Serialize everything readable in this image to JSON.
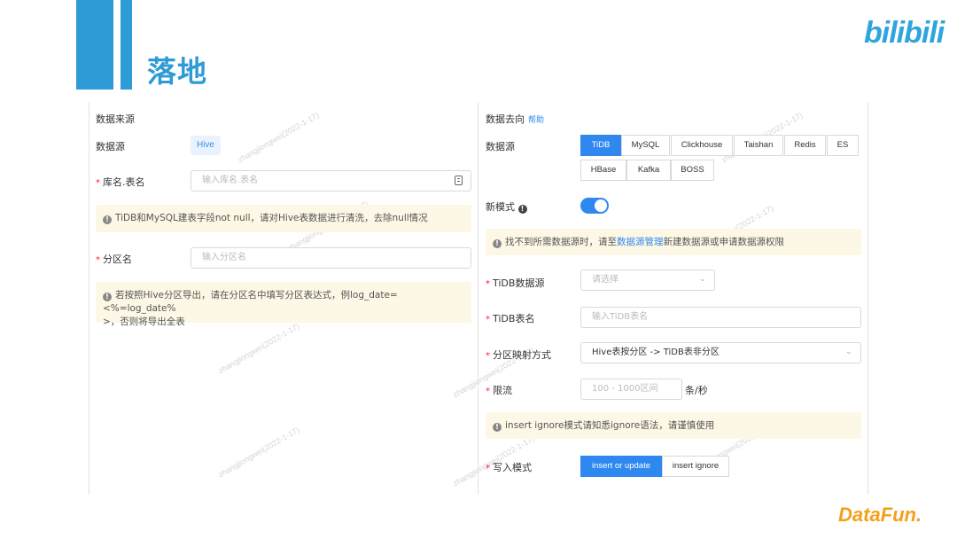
{
  "slide": {
    "title": "落地",
    "logo_bilibili": "bilibili",
    "logo_datafun": "DataFun."
  },
  "source": {
    "section_title": "数据来源",
    "datasource_label": "数据源",
    "datasource_value": "Hive",
    "table_label": "库名.表名",
    "table_placeholder": "输入库名.表名",
    "notice1": "TiDB和MySQL建表字段not null，请对Hive表数据进行清洗，去除null情况",
    "partition_label": "分区名",
    "partition_placeholder": "输入分区名",
    "notice2_line1": "若按照Hive分区导出，请在分区名中填写分区表达式，例log_date=<%=log_date%",
    "notice2_line2": ">，否则将导出全表"
  },
  "target": {
    "section_title": "数据去向",
    "help": "帮助",
    "datasource_label": "数据源",
    "datasources": [
      "TiDB",
      "MySQL",
      "Clickhouse",
      "Taishan",
      "Redis",
      "ES",
      "HBase",
      "Kafka",
      "BOSS"
    ],
    "selected_datasource": "TiDB",
    "new_mode_label": "新模式",
    "new_mode_on": true,
    "notice_pre": "找不到所需数据源时，请至",
    "notice_link": "数据源管理",
    "notice_post": "新建数据源或申请数据源权限",
    "tidb_source_label": "TiDB数据源",
    "tidb_source_placeholder": "请选择",
    "tidb_table_label": "TiDB表名",
    "tidb_table_placeholder": "输入TiDB表名",
    "partition_map_label": "分区映射方式",
    "partition_map_value": "Hive表按分区 -> TiDB表非分区",
    "rate_label": "限流",
    "rate_placeholder": "100 - 1000区间",
    "rate_unit": "条/秒",
    "notice_insert": "insert ignore模式请知悉ignore语法，请谨慎使用",
    "write_mode_label": "写入模式",
    "write_modes": [
      "insert or update",
      "insert ignore"
    ],
    "selected_write_mode": "insert or update"
  },
  "watermark": "zhangjiongwei(2022-1-17)",
  "colors": {
    "accent": "#2e9bd6",
    "primary_blue": "#2e88f0",
    "notice_bg": "#fdf7e6",
    "datafun_orange": "#f5a01a"
  }
}
